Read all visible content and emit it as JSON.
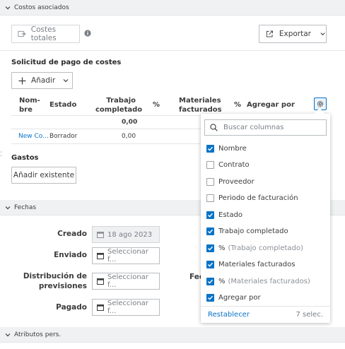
{
  "costs_section": {
    "title": "Costos asociados"
  },
  "toolbar": {
    "total_costs_label": "Costes totales",
    "export_label": "Exportar"
  },
  "payment_request": {
    "title": "Solicitud de pago de costes",
    "add_label": "Añadir",
    "columns": [
      "Nom-bre",
      "Estado",
      "Trabajo completado",
      "%",
      "Materiales facturados",
      "%",
      "Agregar por"
    ],
    "total_row": {
      "work": "0,00"
    },
    "rows": [
      {
        "name": "New Co...",
        "status": "Borrador",
        "work": "0,00"
      }
    ]
  },
  "expenses": {
    "title": "Gastos",
    "add_existing_label": "Añadir existente"
  },
  "dates_section": {
    "title": "Fechas",
    "fields": [
      {
        "label": "Creado",
        "value": "18 ago 2023"
      },
      {
        "label": "Enviado",
        "placeholder": "Seleccionar f..."
      },
      {
        "label": "Distribución de previsiones",
        "placeholder": "Seleccionar f..."
      },
      {
        "label": "Pagado",
        "placeholder": "Seleccionar f..."
      }
    ],
    "right_label_fragment": "Fec"
  },
  "attributes_section": {
    "title": "Atributos pers."
  },
  "column_picker": {
    "search_placeholder": "Buscar columnas",
    "options": [
      {
        "label": "Nombre",
        "sub": "",
        "checked": true
      },
      {
        "label": "Contrato",
        "sub": "",
        "checked": false
      },
      {
        "label": "Proveedor",
        "sub": "",
        "checked": false
      },
      {
        "label": "Periodo de facturación",
        "sub": "",
        "checked": false
      },
      {
        "label": "Estado",
        "sub": "",
        "checked": true
      },
      {
        "label": "Trabajo completado",
        "sub": "",
        "checked": true
      },
      {
        "label": "%",
        "sub": "(Trabajo completado)",
        "checked": true
      },
      {
        "label": "Materiales facturados",
        "sub": "",
        "checked": true
      },
      {
        "label": "%",
        "sub": "(Materiales facturados)",
        "checked": true
      },
      {
        "label": "Agregar por",
        "sub": "",
        "checked": true
      }
    ],
    "reset_label": "Restablecer",
    "selected_count": "7 selec."
  },
  "colors": {
    "accent": "#0a73c7",
    "header_bg": "#f0f1f2"
  }
}
